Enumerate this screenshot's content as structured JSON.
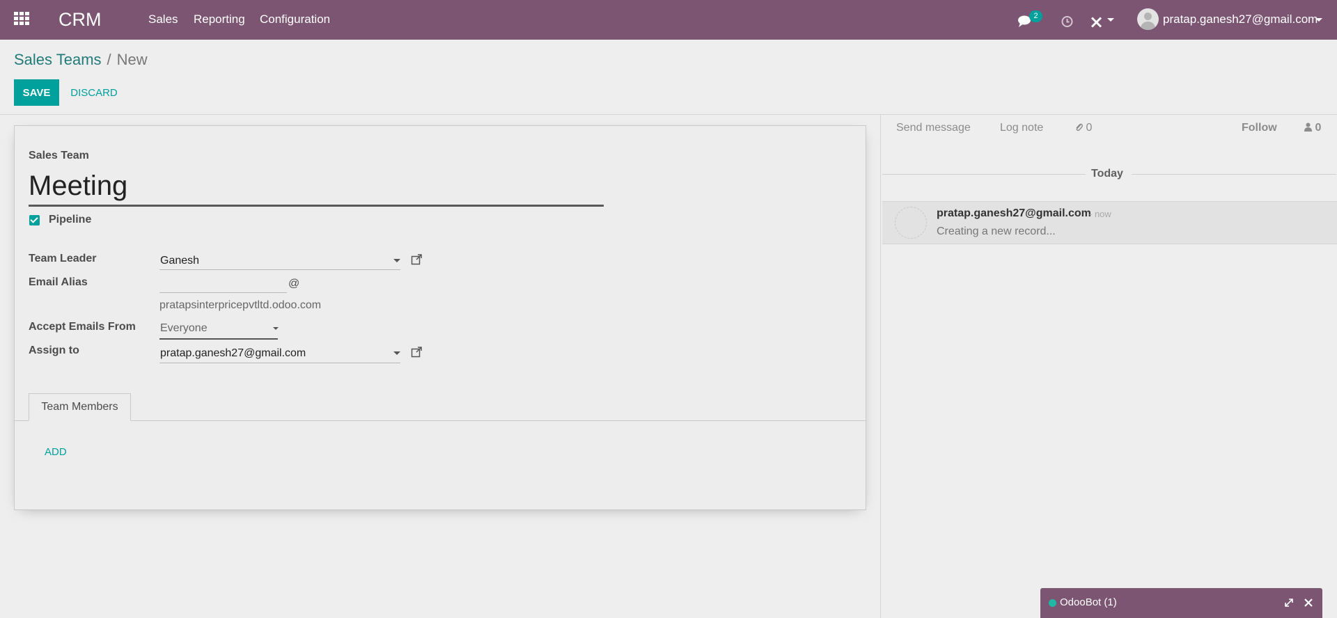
{
  "navbar": {
    "brand": "CRM",
    "menu": [
      "Sales",
      "Reporting",
      "Configuration"
    ],
    "chat_count": "2",
    "user": "pratap.ganesh27@gmail.com"
  },
  "breadcrumb": {
    "parent": "Sales Teams",
    "separator": "/",
    "current": "New"
  },
  "actions": {
    "save": "SAVE",
    "discard": "DISCARD"
  },
  "form": {
    "name_label": "Sales Team",
    "name_value": "Meeting",
    "pipeline_label": "Pipeline",
    "pipeline_checked": true,
    "team_leader_label": "Team Leader",
    "team_leader_value": "Ganesh",
    "email_alias_label": "Email Alias",
    "email_alias_value": "",
    "email_at": "@",
    "email_domain": "pratapsinterpricepvtltd.odoo.com",
    "accept_label": "Accept Emails From",
    "accept_value": "Everyone",
    "assign_label": "Assign to",
    "assign_value": "pratap.ganesh27@gmail.com",
    "tab": "Team Members",
    "add": "ADD"
  },
  "chatter": {
    "send_message": "Send message",
    "log_note": "Log note",
    "attachments": "0",
    "follow": "Follow",
    "followers": "0",
    "today": "Today",
    "message": {
      "author": "pratap.ganesh27@gmail.com",
      "time": "- now",
      "body": "Creating a new record..."
    }
  },
  "odoobot": {
    "title": "OdooBot (1)"
  },
  "colors": {
    "navbar": "#7c5572",
    "accent": "#00a09d",
    "link": "#227b7a"
  }
}
